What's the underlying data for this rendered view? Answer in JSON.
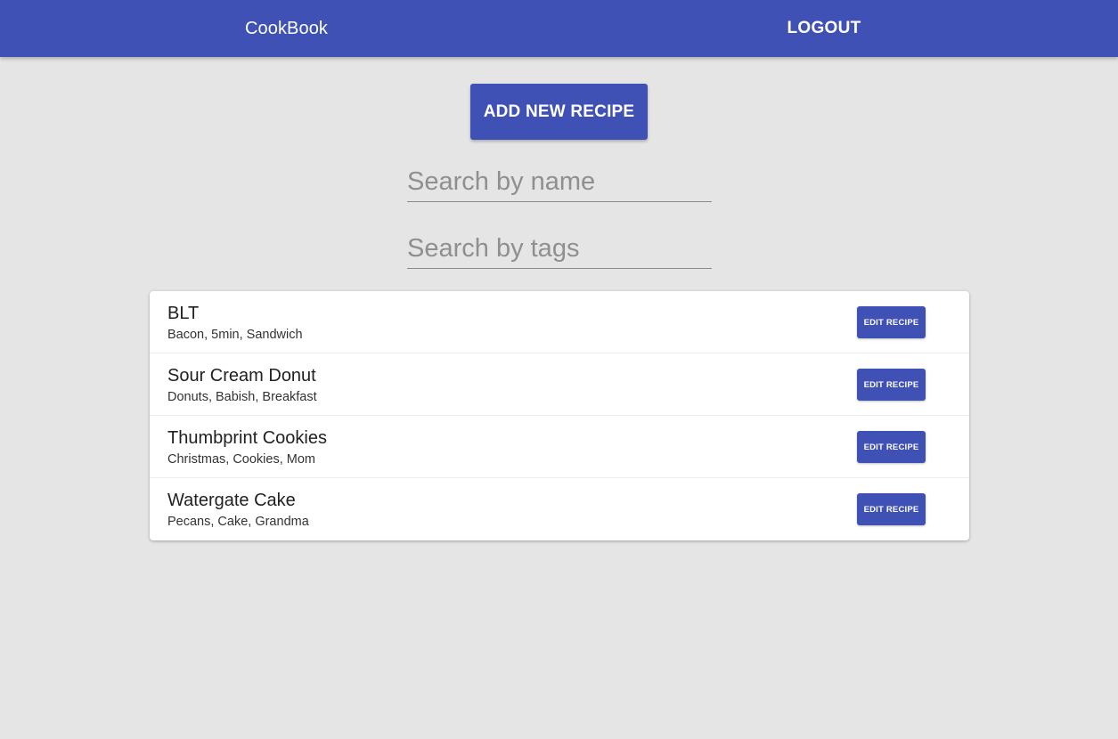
{
  "header": {
    "title": "CookBook",
    "logout_label": "LOGOUT"
  },
  "actions": {
    "add_label": "ADD NEW RECIPE"
  },
  "search": {
    "name_placeholder": "Search by name",
    "tags_placeholder": "Search by tags"
  },
  "recipes": [
    {
      "name": "BLT",
      "tags": "Bacon, 5min, Sandwich",
      "edit_label": "EDIT RECIPE"
    },
    {
      "name": "Sour Cream Donut",
      "tags": "Donuts, Babish, Breakfast",
      "edit_label": "EDIT RECIPE"
    },
    {
      "name": "Thumbprint Cookies",
      "tags": "Christmas, Cookies, Mom",
      "edit_label": "EDIT RECIPE"
    },
    {
      "name": "Watergate Cake",
      "tags": "Pecans, Cake, Grandma",
      "edit_label": "EDIT RECIPE"
    }
  ],
  "colors": {
    "primary": "#3f51b5",
    "background": "#e5e5e5",
    "card": "#ffffff"
  }
}
